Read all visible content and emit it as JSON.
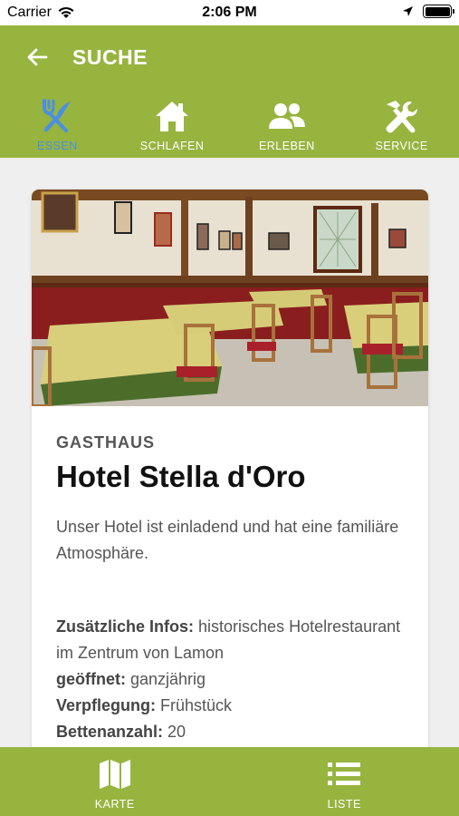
{
  "status_bar": {
    "carrier": "Carrier",
    "time": "2:06 PM"
  },
  "header": {
    "title": "SUCHE",
    "back_icon": "arrow-left-icon"
  },
  "tabs": [
    {
      "label": "ESSEN",
      "icon": "fork-knife-icon",
      "active": true
    },
    {
      "label": "SCHLAFEN",
      "icon": "house-icon",
      "active": false
    },
    {
      "label": "ERLEBEN",
      "icon": "people-icon",
      "active": false
    },
    {
      "label": "SERVICE",
      "icon": "tools-icon",
      "active": false
    }
  ],
  "card": {
    "category": "GASTHAUS",
    "title": "Hotel Stella d'Oro",
    "description": "Unser Hotel ist einladend und hat eine familiäre Atmosphäre.",
    "infos": [
      {
        "label": "Zusätzliche Infos:",
        "value": "historisches Hotelrestaurant im Zentrum von Lamon"
      },
      {
        "label": "geöffnet:",
        "value": "ganzjährig"
      },
      {
        "label": "Verpflegung:",
        "value": "Frühstück"
      },
      {
        "label": "Bettenanzahl:",
        "value": "20"
      }
    ]
  },
  "bottom_nav": [
    {
      "label": "KARTE",
      "icon": "map-icon"
    },
    {
      "label": "LISTE",
      "icon": "list-icon"
    }
  ],
  "colors": {
    "brand_green": "#97b43f",
    "active_tab": "#4a90e2",
    "background": "#efefef"
  }
}
